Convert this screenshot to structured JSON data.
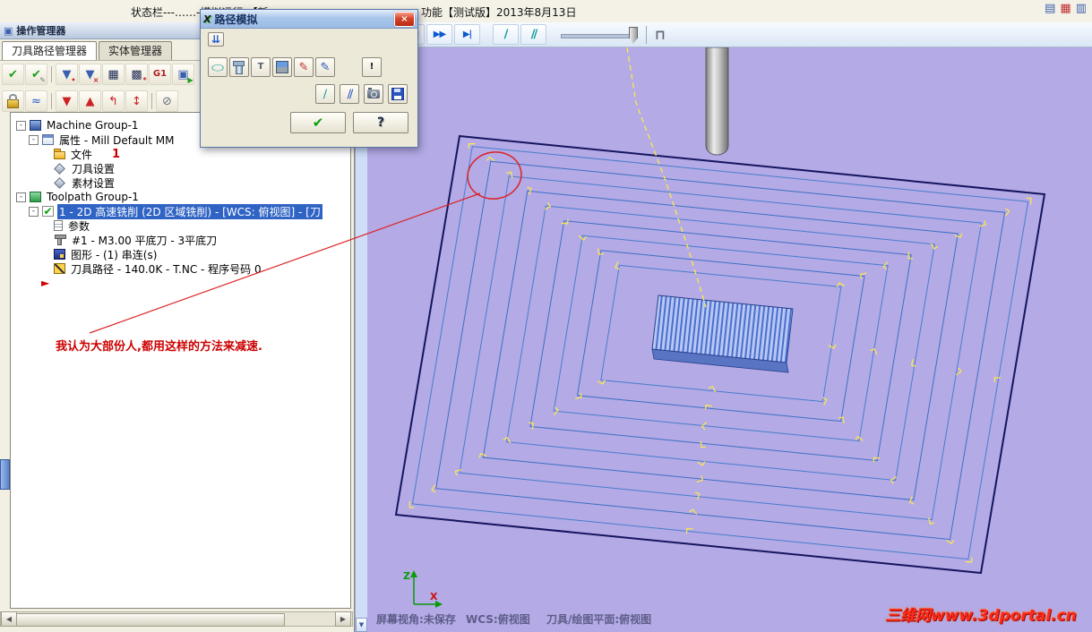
{
  "window": {
    "top_text_left": "状态栏---……-模拟运行-【新",
    "top_text_right": "功能【测试版】2013年8月13日",
    "top_right_icons": [
      {
        "name": "window-grid-icon",
        "glyph": "▤",
        "color": "#3a5fae"
      },
      {
        "name": "window-split-icon",
        "glyph": "▦",
        "color": "#c03030"
      },
      {
        "name": "window-layout-icon",
        "glyph": "▥",
        "color": "#3a5fae"
      }
    ]
  },
  "panel": {
    "header": "操作管理器",
    "header_icon": "▣",
    "tabs": [
      {
        "label": "刀具路径管理器",
        "active": true
      },
      {
        "label": "实体管理器",
        "active": false
      }
    ],
    "toolbar_row1": [
      {
        "name": "select-all-icon",
        "glyph": "✔",
        "color": "#18a018"
      },
      {
        "name": "select-edit-icon",
        "glyph": "✔",
        "color": "#18a018",
        "badge": "✎",
        "badgeColor": "#777777"
      },
      {
        "kind": "sep"
      },
      {
        "name": "filter-icon",
        "glyph": "▼",
        "color": "#3a5fae",
        "badge": "•",
        "badgeColor": "#cc2222"
      },
      {
        "name": "filter-off-icon",
        "glyph": "▼",
        "color": "#3a5fae",
        "badge": "×",
        "badgeColor": "#cc2222"
      },
      {
        "name": "regen-selected-icon",
        "glyph": "▦",
        "color": "#1e2a55"
      },
      {
        "name": "regen-all-icon",
        "glyph": "▩",
        "color": "#1e2a55",
        "badge": "*",
        "badgeColor": "#cc2222"
      },
      {
        "name": "g1-post-icon",
        "glyph": "G1",
        "color": "#b02020",
        "text": true
      },
      {
        "name": "verify-icon",
        "glyph": "▣",
        "color": "#3a5fae",
        "badge": "▶",
        "badgeColor": "#18a018"
      }
    ],
    "toolbar_row2": [
      {
        "name": "lock-icon",
        "type": "lock"
      },
      {
        "name": "toggle-display-icon",
        "glyph": "≈",
        "color": "#2255cc"
      },
      {
        "kind": "sep"
      },
      {
        "name": "move-down-icon",
        "glyph": "▼",
        "color": "#cc2222"
      },
      {
        "name": "move-up-icon",
        "glyph": "▲",
        "color": "#cc2222"
      },
      {
        "name": "insert-return-icon",
        "glyph": "↰",
        "color": "#cc2222"
      },
      {
        "name": "scroll-insert-icon",
        "glyph": "↕",
        "color": "#cc2222"
      },
      {
        "kind": "sep"
      },
      {
        "name": "no-display-icon",
        "glyph": "⊘",
        "color": "#66707a"
      }
    ],
    "tree": [
      {
        "key": "machine-group",
        "level": 0,
        "expander": true,
        "icon": "machine",
        "iconName": "machine-group-icon",
        "label": "Machine Group-1"
      },
      {
        "key": "properties",
        "level": 1,
        "expander": true,
        "icon": "props",
        "iconName": "properties-icon",
        "label": "属性 - Mill Default MM"
      },
      {
        "key": "files",
        "level": 2,
        "icon": "folder",
        "iconName": "folder-icon",
        "label": "文件",
        "badge": "1"
      },
      {
        "key": "tool-settings",
        "level": 2,
        "icon": "diamond",
        "iconName": "tool-settings-icon",
        "label": "刀具设置"
      },
      {
        "key": "stock-settings",
        "level": 2,
        "icon": "diamond",
        "iconName": "stock-settings-icon",
        "label": "素材设置"
      },
      {
        "key": "toolpath-group",
        "level": 0,
        "expander": true,
        "icon": "group",
        "iconName": "toolpath-group-icon",
        "label": "Toolpath Group-1"
      },
      {
        "key": "operation-1",
        "level": 1,
        "expander": true,
        "icon": "opcheck",
        "iconName": "operation-check-icon",
        "glyph": "✔",
        "label": "1 - 2D 高速铣削 (2D 区域铣削) - [WCS: 俯视图] - [刀",
        "selected": true
      },
      {
        "key": "parameters",
        "level": 2,
        "icon": "page",
        "iconName": "parameters-icon",
        "label": "参数"
      },
      {
        "key": "tool",
        "level": 2,
        "icon": "toolbit",
        "iconName": "tool-icon",
        "label": "#1 - M3.00 平底刀 - 3平底刀"
      },
      {
        "key": "geometry",
        "level": 2,
        "icon": "geom",
        "iconName": "geometry-icon",
        "label": "图形 - (1) 串连(s)"
      },
      {
        "key": "toolpath",
        "level": 2,
        "icon": "path",
        "iconName": "toolpath-file-icon",
        "label": "刀具路径 - 140.0K - T.NC - 程序号码 0"
      },
      {
        "key": "insert-position",
        "level": 1,
        "icon": "arrow",
        "iconName": "insert-position-icon",
        "glyph": "►",
        "label": ""
      }
    ],
    "annotation": "我认为大部份人,都用这样的方法来减速."
  },
  "dialog": {
    "title": "路径模拟",
    "icon_glyph": "X",
    "close_glyph": "×",
    "expand_glyph": "⇊",
    "toolbar_row1": [
      {
        "name": "loop-mode-icon",
        "glyph": "◯",
        "color": "#0a9a9a",
        "squash": true
      },
      {
        "name": "show-tool-icon",
        "type": "toolglyph"
      },
      {
        "name": "show-holder-icon",
        "glyph": "T",
        "color": "#556070",
        "text": true
      },
      {
        "name": "show-rapid-icon",
        "type": "holder"
      },
      {
        "name": "trace-mode-icon",
        "glyph": "✎",
        "color": "#c03030"
      },
      {
        "name": "draw-mode-icon",
        "glyph": "✎",
        "color": "#2a55c0"
      },
      {
        "kind": "gap"
      },
      {
        "name": "details-icon",
        "glyph": "!",
        "color": "#111111",
        "text": true
      }
    ],
    "toolbar_row2": [
      {
        "name": "slash-display-icon",
        "glyph": "∕",
        "color": "#0a9a9a"
      },
      {
        "name": "hatch-display-icon",
        "glyph": "∕∕",
        "color": "#2a55c0"
      },
      {
        "name": "snapshot-icon",
        "type": "cam"
      },
      {
        "name": "save-path-icon",
        "type": "floppy"
      }
    ],
    "ok_glyph": "✔",
    "help_glyph": "?"
  },
  "playback": {
    "buttons": [
      {
        "name": "go-start-icon",
        "glyph": "|◀"
      },
      {
        "name": "step-back-icon",
        "glyph": "◀◀"
      },
      {
        "name": "play-icon",
        "glyph": "▶▶"
      },
      {
        "name": "go-end-icon",
        "glyph": "▶|"
      }
    ],
    "aux": [
      {
        "name": "backplot-slash-icon",
        "glyph": "∕",
        "color": "#0a9a9a"
      },
      {
        "name": "backplot-hatch-icon",
        "glyph": "∕∕",
        "color": "#0a9a9a"
      }
    ],
    "clamp_glyph": "⊓"
  },
  "viewport": {
    "status": {
      "view": "屏幕视角:未保存",
      "wcs": "WCS:俯视图",
      "plane": "刀具/绘图平面:俯视图"
    },
    "watermark": "三维网www.3dportal.cn",
    "axis": {
      "z": "Z",
      "x": "X"
    }
  }
}
